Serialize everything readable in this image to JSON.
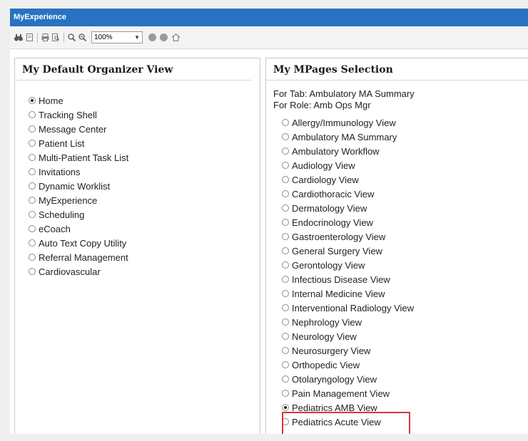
{
  "window": {
    "title": "MyExperience"
  },
  "toolbar": {
    "zoom_value": "100%",
    "icons": [
      "binoculars-icon",
      "page-icon",
      "print-icon",
      "print-preview-icon",
      "zoom-in-icon",
      "zoom-out-icon",
      "back-circle-icon",
      "forward-circle-icon",
      "home-icon"
    ]
  },
  "left_panel": {
    "title": "My Default Organizer View",
    "options": [
      {
        "label": "Home",
        "selected": true
      },
      {
        "label": "Tracking Shell",
        "selected": false
      },
      {
        "label": "Message Center",
        "selected": false
      },
      {
        "label": "Patient List",
        "selected": false
      },
      {
        "label": "Multi-Patient Task List",
        "selected": false
      },
      {
        "label": "Invitations",
        "selected": false
      },
      {
        "label": "Dynamic Worklist",
        "selected": false
      },
      {
        "label": "MyExperience",
        "selected": false
      },
      {
        "label": "Scheduling",
        "selected": false
      },
      {
        "label": "eCoach",
        "selected": false
      },
      {
        "label": "Auto Text Copy Utility",
        "selected": false
      },
      {
        "label": "Referral Management",
        "selected": false
      },
      {
        "label": "Cardiovascular",
        "selected": false
      }
    ]
  },
  "right_panel": {
    "title": "My MPages Selection",
    "for_tab": "For Tab:  Ambulatory MA Summary",
    "for_role": "For Role:  Amb Ops Mgr",
    "options": [
      {
        "label": "Allergy/Immunology View",
        "selected": false
      },
      {
        "label": "Ambulatory MA Summary",
        "selected": false
      },
      {
        "label": "Ambulatory Workflow",
        "selected": false
      },
      {
        "label": "Audiology View",
        "selected": false
      },
      {
        "label": "Cardiology View",
        "selected": false
      },
      {
        "label": "Cardiothoracic View",
        "selected": false
      },
      {
        "label": "Dermatology View",
        "selected": false
      },
      {
        "label": "Endocrinology View",
        "selected": false
      },
      {
        "label": "Gastroenterology View",
        "selected": false
      },
      {
        "label": "General Surgery View",
        "selected": false
      },
      {
        "label": "Gerontology View",
        "selected": false
      },
      {
        "label": "Infectious Disease View",
        "selected": false
      },
      {
        "label": "Internal Medicine View",
        "selected": false
      },
      {
        "label": "Interventional Radiology View",
        "selected": false
      },
      {
        "label": "Nephrology View",
        "selected": false
      },
      {
        "label": "Neurology View",
        "selected": false
      },
      {
        "label": "Neurosurgery View",
        "selected": false
      },
      {
        "label": "Orthopedic View",
        "selected": false
      },
      {
        "label": "Otolaryngology View",
        "selected": false
      },
      {
        "label": "Pain Management View",
        "selected": false
      },
      {
        "label": "Pediatrics AMB View",
        "selected": true
      },
      {
        "label": "Pediatrics Acute View",
        "selected": false
      }
    ]
  },
  "colors": {
    "titlebar": "#2872c2",
    "highlight_box": "#d9363e"
  }
}
